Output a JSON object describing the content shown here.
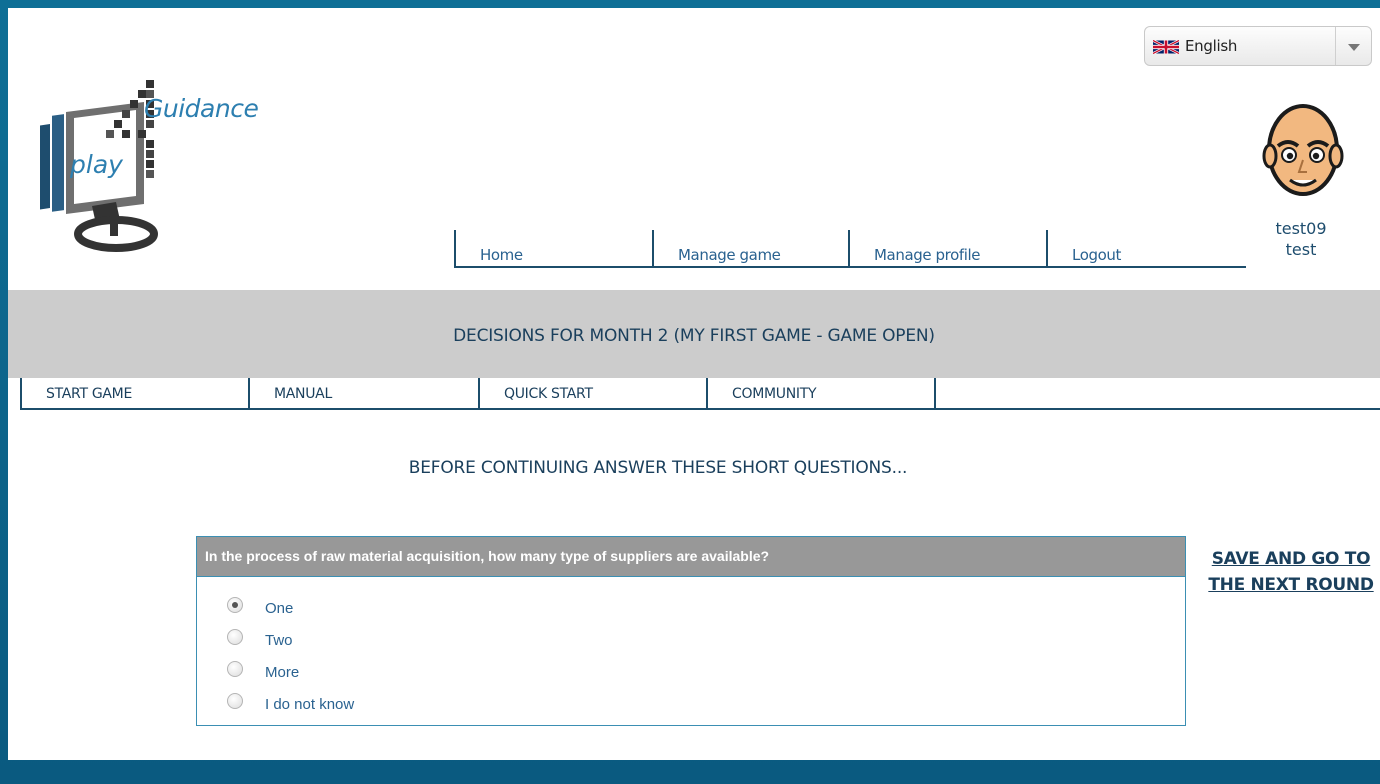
{
  "language": {
    "selected": "English",
    "icon": "uk-flag-icon"
  },
  "logo": {
    "text_top": "Guidance",
    "text_bottom": "play"
  },
  "user": {
    "username": "test09",
    "name": "test",
    "avatar_icon": "avatar-face-icon"
  },
  "top_nav": {
    "items": [
      {
        "label": "Home"
      },
      {
        "label": "Manage game"
      },
      {
        "label": "Manage profile"
      },
      {
        "label": "Logout"
      }
    ]
  },
  "banner": {
    "title": "DECISIONS FOR MONTH 2 (MY FIRST GAME - GAME OPEN)"
  },
  "sub_nav": {
    "items": [
      {
        "label": "START GAME"
      },
      {
        "label": "MANUAL"
      },
      {
        "label": "QUICK START"
      },
      {
        "label": "COMMUNITY"
      }
    ]
  },
  "main": {
    "heading": "BEFORE CONTINUING ANSWER THESE SHORT QUESTIONS...",
    "question": "In the process of raw material acquisition, how many type of suppliers are available?",
    "options": [
      {
        "label": "One",
        "selected": true
      },
      {
        "label": "Two",
        "selected": false
      },
      {
        "label": "More",
        "selected": false
      },
      {
        "label": "I do not know",
        "selected": false
      }
    ],
    "save_link": "SAVE AND GO TO THE NEXT ROUND"
  },
  "colors": {
    "frame": "#0e6f96",
    "banner": "#cccccc",
    "nav_text": "#2a6290",
    "heading_text": "#1a3f5c",
    "question_header": "#989898",
    "box_border": "#3b8fb3"
  }
}
